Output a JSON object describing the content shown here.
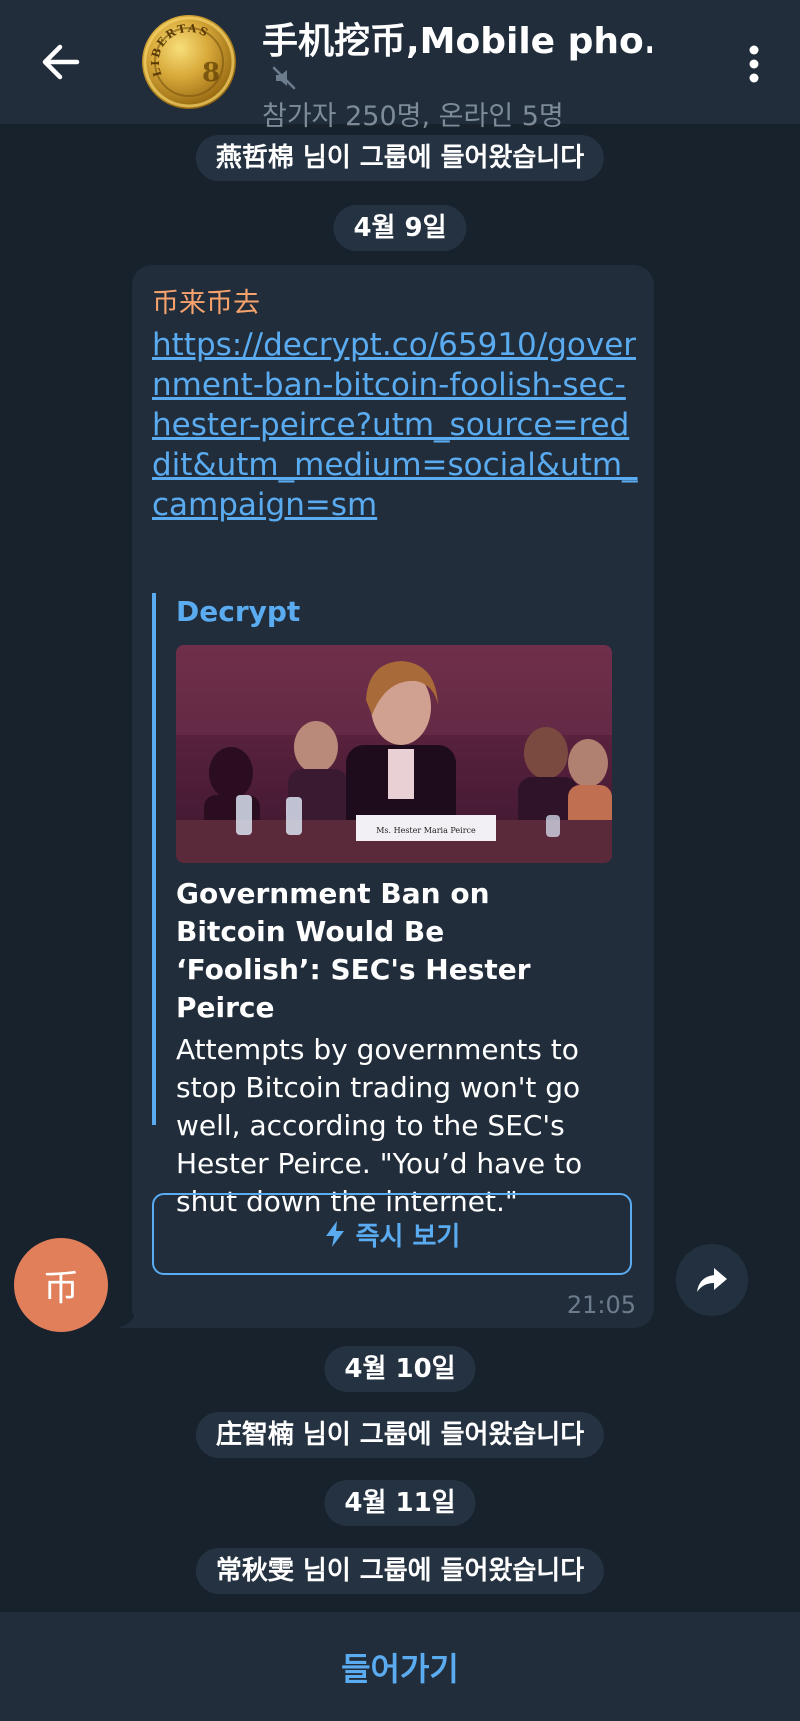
{
  "header": {
    "title": "手机挖币,Mobile pho...",
    "subtitle": "참가자 250명, 온라인 5명",
    "avatar_coin_text": "LIBERTAS"
  },
  "service_messages": {
    "joined_1": "燕哲棉 님이 그룹에 들어왔습니다",
    "date_1": "4월 9일",
    "date_2": "4월 10일",
    "joined_2": "庄智楠 님이 그룹에 들어왔습니다",
    "date_3": "4월 11일",
    "joined_3": "常秋雯 님이 그룹에 들어왔습니다"
  },
  "message": {
    "sender": "币来币去",
    "link": "https://decrypt.co/65910/government-ban-bitcoin-foolish-sec-hester-peirce?utm_source=reddit&utm_medium=social&utm_campaign=sm",
    "preview": {
      "site": "Decrypt",
      "image_placard": "Ms. Hester Maria Peirce",
      "title": "Government Ban on Bitcoin Would Be ‘Foolish’: SEC's Hester Peirce",
      "description": "Attempts by governments to stop Bitcoin trading won't go well, according to the SEC's Hester Peirce. \"You’d have to shut down the internet.\""
    },
    "instant_view_label": "즉시 보기",
    "time": "21:05",
    "avatar_initial": "币"
  },
  "bottom": {
    "join_label": "들어가기"
  },
  "colors": {
    "background": "#18222d",
    "header": "#212d3b",
    "bubble": "#212d3b",
    "link": "#5aabf0",
    "sender_name": "#f7a26d",
    "avatar": "#e27f5b"
  }
}
